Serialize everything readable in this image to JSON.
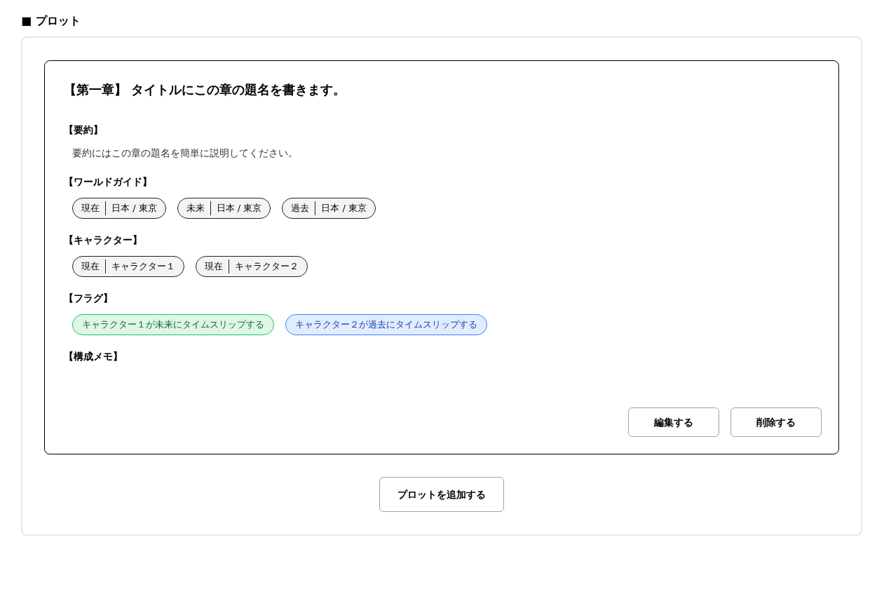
{
  "heading": "■ プロット",
  "plots": [
    {
      "title": "【第一章】 タイトルにこの章の題名を書きます。",
      "sections": [
        {
          "kind": "text",
          "label": "【要約】",
          "text": "要約にはこの章の題名を簡単に説明してください。"
        },
        {
          "kind": "tags",
          "label": "【ワールドガイド】",
          "tags": [
            {
              "time": "現在",
              "name": "日本 / 東京"
            },
            {
              "time": "未来",
              "name": "日本 / 東京"
            },
            {
              "time": "過去",
              "name": "日本 / 東京"
            }
          ]
        },
        {
          "kind": "tags",
          "label": "【キャラクター】",
          "tags": [
            {
              "time": "現在",
              "name": "キャラクター１"
            },
            {
              "time": "現在",
              "name": "キャラクター２"
            }
          ]
        },
        {
          "kind": "flags",
          "label": "【フラグ】",
          "flags": [
            {
              "text": "キャラクター１が未来にタイムスリップする",
              "color": "#22c55e"
            },
            {
              "text": "キャラクター２が過去にタイムスリップする",
              "color": "#3b82f6"
            }
          ]
        },
        {
          "kind": "memo",
          "label": "【構成メモ】"
        }
      ],
      "buttons": [
        "編集する",
        "削除する"
      ]
    }
  ],
  "add_button": "プロットを追加する"
}
